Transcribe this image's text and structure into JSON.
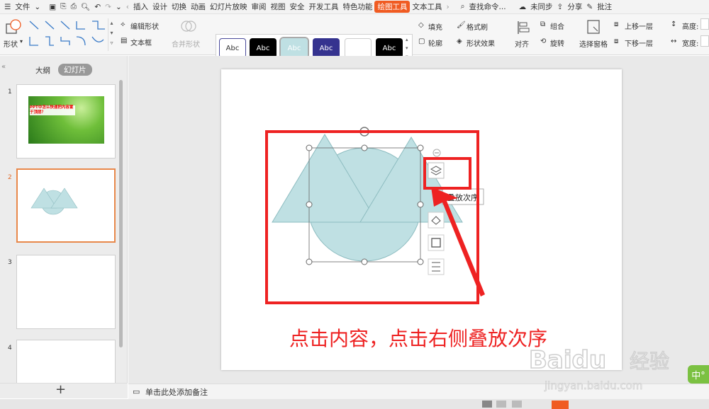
{
  "menu": {
    "file": "文件",
    "items": [
      "插入",
      "设计",
      "切换",
      "动画",
      "幻灯片放映",
      "审阅",
      "视图",
      "安全",
      "开发工具",
      "特色功能"
    ],
    "active_tab": "绘图工具",
    "text_tool": "文本工具",
    "search": "查找命令...",
    "sync": "未同步",
    "share": "分享",
    "annotate": "批注"
  },
  "ribbon": {
    "shape_label": "形状",
    "edit_shape": "编辑形状",
    "text_box": "文本框",
    "merge_shape": "合并形状",
    "style_label": "Abc",
    "fill": "填充",
    "outline": "轮廓",
    "format_brush": "格式刷",
    "shape_effect": "形状效果",
    "align": "对齐",
    "group": "组合",
    "rotate": "旋转",
    "select_pane": "选择窗格",
    "bring_forward": "上移一层",
    "send_backward": "下移一层",
    "height": "高度:",
    "width": "宽度:"
  },
  "panel": {
    "outline_tab": "大纲",
    "slides_tab": "幻灯片",
    "slide1_text": "PPT中怎么快速把内容置于顶层？",
    "slide_numbers": [
      "1",
      "2",
      "3",
      "4"
    ],
    "add": "+"
  },
  "slide": {
    "tooltip": "叠放次序",
    "instruction": "点击内容，点击右侧叠放次序"
  },
  "notes": "单击此处添加备注",
  "watermark": {
    "brand": "Baidu",
    "brand_cn": "经验",
    "url": "jingyan.baidu.com"
  },
  "ime": "中°",
  "colors": {
    "accent": "#f05b22",
    "highlight_red": "#ee2222",
    "shape_fill": "#bfe0e3",
    "shape_stroke": "#8dbcc0"
  }
}
